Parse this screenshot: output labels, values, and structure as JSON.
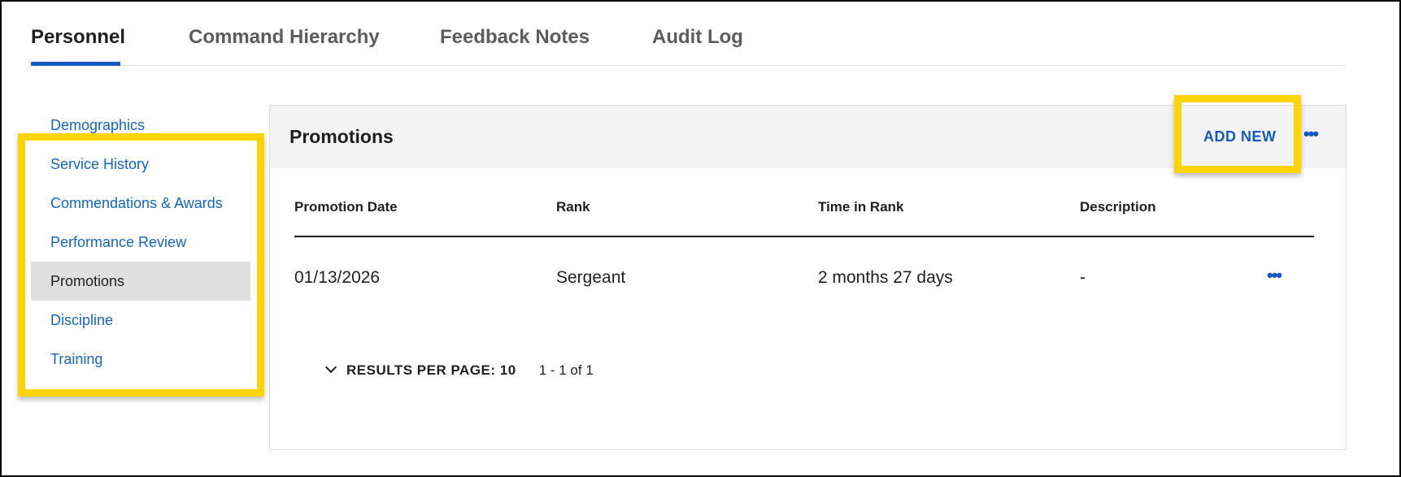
{
  "tabs": [
    {
      "label": "Personnel",
      "active": true
    },
    {
      "label": "Command Hierarchy",
      "active": false
    },
    {
      "label": "Feedback Notes",
      "active": false
    },
    {
      "label": "Audit Log",
      "active": false
    }
  ],
  "sidenav": {
    "items": [
      {
        "label": "Demographics"
      },
      {
        "label": "Service History"
      },
      {
        "label": "Commendations & Awards"
      },
      {
        "label": "Performance Review"
      },
      {
        "label": "Promotions",
        "active": true
      },
      {
        "label": "Discipline"
      },
      {
        "label": "Training"
      }
    ]
  },
  "card": {
    "title": "Promotions",
    "add_new_label": "ADD NEW",
    "more_icon": "more-horizontal-icon"
  },
  "table": {
    "columns": [
      "Promotion Date",
      "Rank",
      "Time in Rank",
      "Description"
    ],
    "rows": [
      {
        "date": "01/13/2026",
        "rank": "Sergeant",
        "time_in_rank": "2 months 27 days",
        "description": "-"
      }
    ]
  },
  "pager": {
    "label": "RESULTS PER PAGE: 10",
    "range": "1 - 1 of 1",
    "icon": "chevron-down-icon"
  },
  "colors": {
    "accent": "#1558c0",
    "highlight": "#ffd400",
    "active_nav_bg": "#e0e0e0"
  }
}
